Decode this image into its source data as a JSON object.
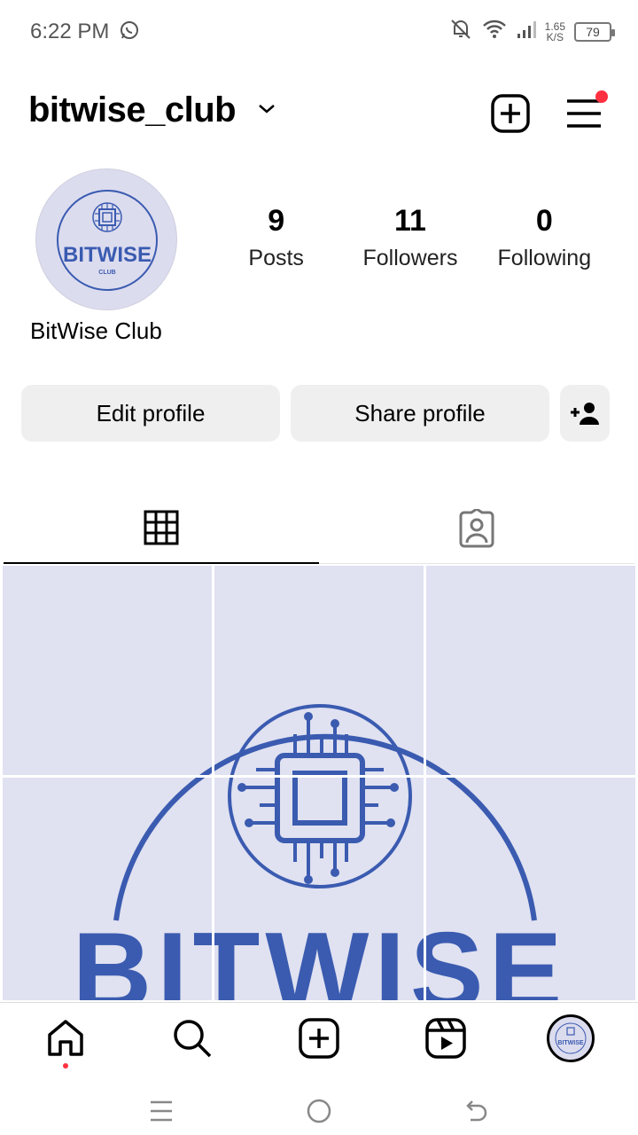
{
  "status_bar": {
    "time": "6:22 PM",
    "net_speed_value": "1.65",
    "net_speed_unit": "K/S",
    "battery": "79"
  },
  "header": {
    "username": "bitwise_club"
  },
  "profile": {
    "display_name": "BitWise Club",
    "logo_text": "BITWISE",
    "logo_subtext": "CLUB",
    "stats": [
      {
        "value": "9",
        "label": "Posts"
      },
      {
        "value": "11",
        "label": "Followers"
      },
      {
        "value": "0",
        "label": "Following"
      }
    ]
  },
  "actions": {
    "edit_label": "Edit profile",
    "share_label": "Share profile"
  },
  "tabs": [
    "grid-tab",
    "tagged-tab"
  ],
  "colors": {
    "brand_blue": "#3a5bb0",
    "post_background": "#e0e1f1",
    "notification_red": "#ff3040"
  }
}
